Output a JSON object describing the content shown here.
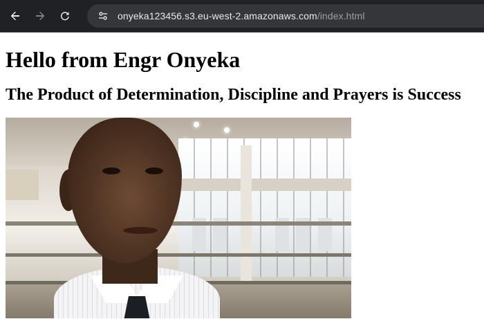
{
  "browser": {
    "back_icon": "arrow-left-icon",
    "forward_icon": "arrow-right-icon",
    "reload_icon": "reload-icon",
    "site_info_icon": "tune-icon",
    "url_host": "onyeka123456.s3.eu-west-2.amazonaws.com",
    "url_path": "/index.html"
  },
  "page": {
    "heading": "Hello from Engr Onyeka",
    "subheading": "The Product of Determination, Discipline and Prayers is Success",
    "photo_subject": "portrait-photo"
  },
  "colors": {
    "toolbar_bg": "#202124",
    "omnibox_bg": "#35363a",
    "url_text": "#e8eaed",
    "url_path_text": "#9aa0a6",
    "page_bg": "#ffffff"
  }
}
